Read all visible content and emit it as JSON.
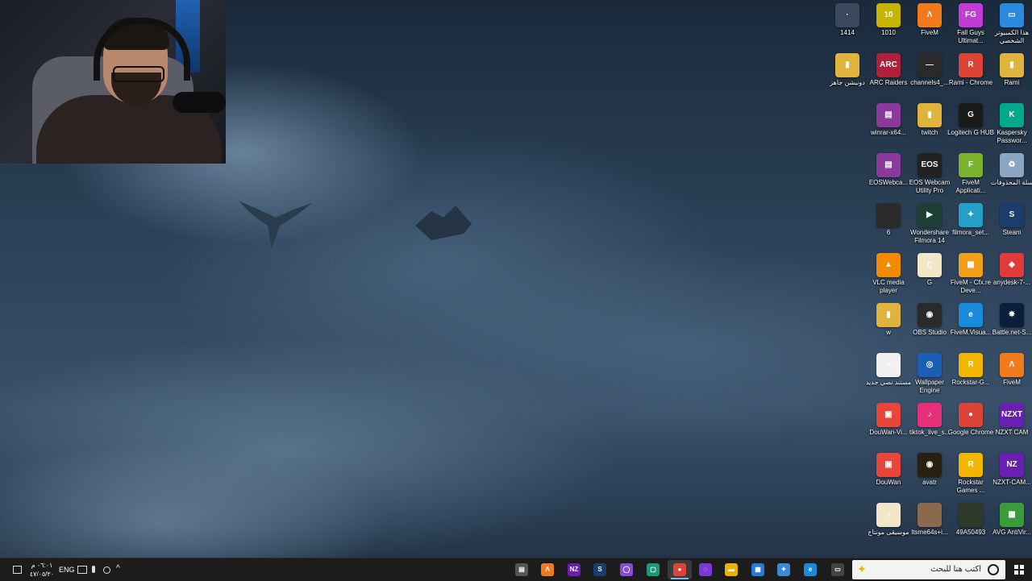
{
  "desktop": {
    "icons": [
      {
        "label": "هذا الكمبيوتر الشخصي",
        "icon": "this-pc-icon",
        "color": "#2b8ae0",
        "glyph": "▭"
      },
      {
        "label": "Fall Guys Ultimat...",
        "icon": "fall-guys-icon",
        "color": "#c23bd6",
        "glyph": "FG"
      },
      {
        "label": "FiveM",
        "icon": "fivem-icon",
        "color": "#f07a1c",
        "glyph": "Λ"
      },
      {
        "label": "1010",
        "icon": "folder-icon",
        "color": "#c8b400",
        "glyph": "10"
      },
      {
        "label": "1414",
        "icon": "shortcut-icon",
        "color": "#3a4a5c",
        "glyph": "·"
      },
      {
        "label": "Rami",
        "icon": "folder-icon",
        "color": "#e0b43c",
        "glyph": "▮"
      },
      {
        "label": "Rami - Chrome",
        "icon": "chrome-icon",
        "color": "#db4437",
        "glyph": "R"
      },
      {
        "label": "channels4_...",
        "icon": "image-icon",
        "color": "#2a2a2a",
        "glyph": "—"
      },
      {
        "label": "ARC Raiders",
        "icon": "arc-raiders-icon",
        "color": "#b0203a",
        "glyph": "ARC"
      },
      {
        "label": "دونيشن جاهز",
        "icon": "folder-icon",
        "color": "#e0b43c",
        "glyph": "▮"
      },
      {
        "label": "Kaspersky Passwor...",
        "icon": "kaspersky-icon",
        "color": "#00a88e",
        "glyph": "K"
      },
      {
        "label": "Logitech G HUB",
        "icon": "logitech-icon",
        "color": "#1a1a1a",
        "glyph": "G"
      },
      {
        "label": "twitch",
        "icon": "folder-icon",
        "color": "#e0b43c",
        "glyph": "▮"
      },
      {
        "label": "winrar-x64...",
        "icon": "winrar-icon",
        "color": "#8b3a9c",
        "glyph": "▤"
      },
      {
        "label": "سلة المحذوفات",
        "icon": "recycle-bin-icon",
        "color": "#8aa6c0",
        "glyph": "♻"
      },
      {
        "label": "FiveM Applicati...",
        "icon": "fivem-app-icon",
        "color": "#7ab32e",
        "glyph": "F"
      },
      {
        "label": "EOS Webcam Utility Pro",
        "icon": "eos-webcam-icon",
        "color": "#222",
        "glyph": "EOS"
      },
      {
        "label": "EOSWebca...",
        "icon": "winrar-icon",
        "color": "#8b3a9c",
        "glyph": "▤"
      },
      {
        "label": "Steam",
        "icon": "steam-icon",
        "color": "#1b3d6b",
        "glyph": "S"
      },
      {
        "label": "filmora_set...",
        "icon": "filmora-setup-icon",
        "color": "#24a0c8",
        "glyph": "✦"
      },
      {
        "label": "Wondershare Filmora 14",
        "icon": "filmora-icon",
        "color": "#1d3f36",
        "glyph": "▶"
      },
      {
        "label": "6",
        "icon": "image-icon",
        "color": "#2b2b2b",
        "glyph": ""
      },
      {
        "label": "anydesk-7-...",
        "icon": "anydesk-icon",
        "color": "#e03a3a",
        "glyph": "◆"
      },
      {
        "label": "FiveM - Cfx.re Deve...",
        "icon": "cfx-icon",
        "color": "#f2a01c",
        "glyph": "▦"
      },
      {
        "label": "G",
        "icon": "document-icon",
        "color": "#f4e6c8",
        "glyph": "▯"
      },
      {
        "label": "VLC media player",
        "icon": "vlc-icon",
        "color": "#f28b00",
        "glyph": "▲"
      },
      {
        "label": "Battle.net-S...",
        "icon": "battlenet-icon",
        "color": "#0b1e3a",
        "glyph": "✸"
      },
      {
        "label": "FiveM.Visua...",
        "icon": "edge-icon",
        "color": "#1a8adb",
        "glyph": "e"
      },
      {
        "label": "OBS Studio",
        "icon": "obs-icon",
        "color": "#2a2a2a",
        "glyph": "◉"
      },
      {
        "label": "w",
        "icon": "folder-icon",
        "color": "#e0b43c",
        "glyph": "▮"
      },
      {
        "label": "FiveM",
        "icon": "fivem-icon",
        "color": "#f07a1c",
        "glyph": "Λ"
      },
      {
        "label": "Rockstar-G...",
        "icon": "rockstar-icon",
        "color": "#f2b600",
        "glyph": "R"
      },
      {
        "label": "Wallpaper Engine",
        "icon": "wallpaper-engine-icon",
        "color": "#1a5fb4",
        "glyph": "◎"
      },
      {
        "label": "مستند نصي جديد",
        "icon": "text-document-icon",
        "color": "#f0f0f0",
        "glyph": "≡"
      },
      {
        "label": "NZXT CAM",
        "icon": "nzxt-icon",
        "color": "#6a1fb3",
        "glyph": "NZXT"
      },
      {
        "label": "Google Chrome",
        "icon": "chrome-icon",
        "color": "#db4437",
        "glyph": "●"
      },
      {
        "label": "tiktok_live_s...",
        "icon": "tiktok-icon",
        "color": "#e6307a",
        "glyph": "♪"
      },
      {
        "label": "DouWan-Vi...",
        "icon": "douwan-icon",
        "color": "#e8463a",
        "glyph": "▣"
      },
      {
        "label": "NZXT-CAM...",
        "icon": "nzxt-icon",
        "color": "#6a1fb3",
        "glyph": "NZ"
      },
      {
        "label": "Rockstar Games ...",
        "icon": "rockstar-icon",
        "color": "#f2b600",
        "glyph": "R"
      },
      {
        "label": "avatr",
        "icon": "avatr-icon",
        "color": "#2a2010",
        "glyph": "◉"
      },
      {
        "label": "DouWan",
        "icon": "douwan-icon",
        "color": "#e8463a",
        "glyph": "▣"
      },
      {
        "label": "AVG AntiVir...",
        "icon": "avg-icon",
        "color": "#3a9b3a",
        "glyph": "▦"
      },
      {
        "label": "49A50493",
        "icon": "image-icon",
        "color": "#2f3a2a",
        "glyph": ""
      },
      {
        "label": "ltsme64s+i...",
        "icon": "image-icon",
        "color": "#8a6a4a",
        "glyph": ""
      },
      {
        "label": "موسيقى مونتاج",
        "icon": "music-folder-icon",
        "color": "#f4e6c8",
        "glyph": "♪"
      }
    ]
  },
  "taskbar": {
    "search_placeholder": "اكتب هنا للبحث",
    "language": "ENG",
    "time": "٠٦:٠١ م",
    "date": "٤٧/٠٥/٢٠",
    "apps": [
      {
        "name": "tb-misc",
        "color": "#555",
        "glyph": "▤"
      },
      {
        "name": "tb-fivem",
        "color": "#f07a1c",
        "glyph": "Λ"
      },
      {
        "name": "tb-nzxt",
        "color": "#6a1fb3",
        "glyph": "NZ"
      },
      {
        "name": "tb-steam",
        "color": "#1b3d6b",
        "glyph": "S"
      },
      {
        "name": "tb-obs-like",
        "color": "#8a4ad8",
        "glyph": "◯"
      },
      {
        "name": "tb-app-green",
        "color": "#1a9a7a",
        "glyph": "▢"
      },
      {
        "name": "tb-chrome",
        "color": "#db4437",
        "glyph": "●"
      },
      {
        "name": "tb-messenger",
        "color": "#7a3ad8",
        "glyph": "◌"
      },
      {
        "name": "tb-explorer",
        "color": "#e8b400",
        "glyph": "▬"
      },
      {
        "name": "tb-store",
        "color": "#2a7ad8",
        "glyph": "▦"
      },
      {
        "name": "tb-copilot",
        "color": "#3a8ad8",
        "glyph": "✦"
      },
      {
        "name": "tb-edge",
        "color": "#1a8adb",
        "glyph": "e"
      },
      {
        "name": "tb-taskview",
        "color": "#444",
        "glyph": "▭"
      }
    ]
  }
}
